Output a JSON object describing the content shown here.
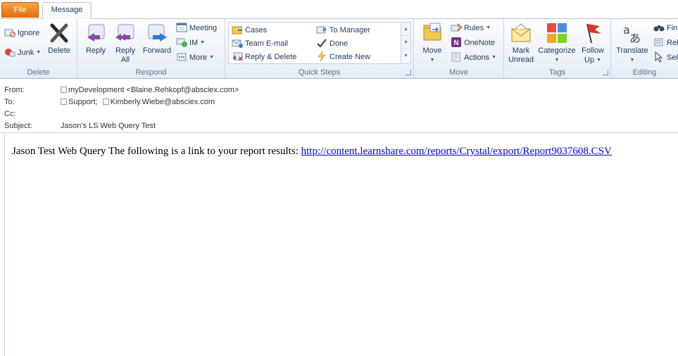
{
  "tabs": {
    "file": "File",
    "message": "Message"
  },
  "ribbon": {
    "delete_group": {
      "label": "Delete",
      "ignore": "Ignore",
      "junk": "Junk",
      "delete": "Delete"
    },
    "respond_group": {
      "label": "Respond",
      "reply": "Reply",
      "reply_all_1": "Reply",
      "reply_all_2": "All",
      "forward": "Forward",
      "meeting": "Meeting",
      "im": "IM",
      "more": "More"
    },
    "quick_steps": {
      "label": "Quick Steps",
      "items": [
        "Cases",
        "Team E-mail",
        "Reply & Delete",
        "To Manager",
        "Done",
        "Create New"
      ]
    },
    "move_group": {
      "label": "Move",
      "move": "Move",
      "rules": "Rules",
      "onenote": "OneNote",
      "actions": "Actions"
    },
    "tags_group": {
      "label": "Tags",
      "mark_unread_1": "Mark",
      "mark_unread_2": "Unread",
      "categorize": "Categorize",
      "follow_up_1": "Follow",
      "follow_up_2": "Up"
    },
    "editing_group": {
      "label": "Editing",
      "translate": "Translate",
      "find": "Fin",
      "related": "Rel",
      "select": "Sel"
    }
  },
  "header": {
    "from_label": "From:",
    "from_value": "myDevelopment <Blaine.Rehkopf@absciex.com>",
    "to_label": "To:",
    "to_values": [
      "Support;",
      "Kimberly.Wiebe@absciex.com"
    ],
    "cc_label": "Cc:",
    "subject_label": "Subject:",
    "subject_value": "Jason's LS Web Query Test"
  },
  "body": {
    "text": "Jason Test Web Query The following is a link to your report results: ",
    "link": "http://content.learnshare.com/reports/Crystal/export/Report9037608.CSV"
  },
  "colors": {
    "file_tab": "#e46b0d",
    "link": "#0000ee",
    "ribbon_text": "#1e395b"
  }
}
